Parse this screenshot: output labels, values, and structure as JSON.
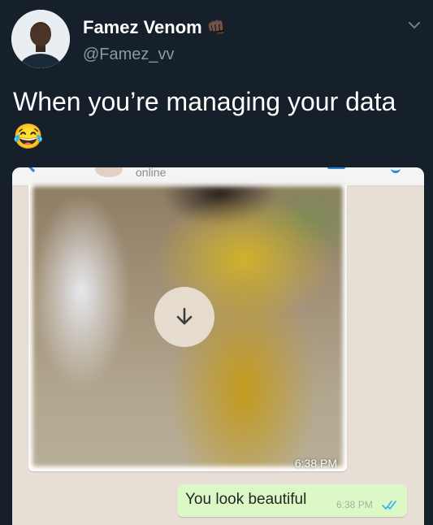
{
  "tweet": {
    "author_name": "Famez Venom",
    "author_emoji": "👊🏿",
    "handle": "@Famez_vv",
    "text": "When you’re managing your data",
    "text_emoji": "😂"
  },
  "chat": {
    "contact_status": "online",
    "image_time": "6:38 PM",
    "message_text": "You look beautiful",
    "message_time": "6:38 PM"
  },
  "icons": {
    "more": "chevron-down-icon",
    "download": "download-arrow-icon",
    "read": "double-check-icon"
  },
  "colors": {
    "background": "#15202b",
    "outgoing_bubble": "#dcf8c6",
    "chat_background": "#e7ded6",
    "read_tick": "#34b7f1"
  }
}
